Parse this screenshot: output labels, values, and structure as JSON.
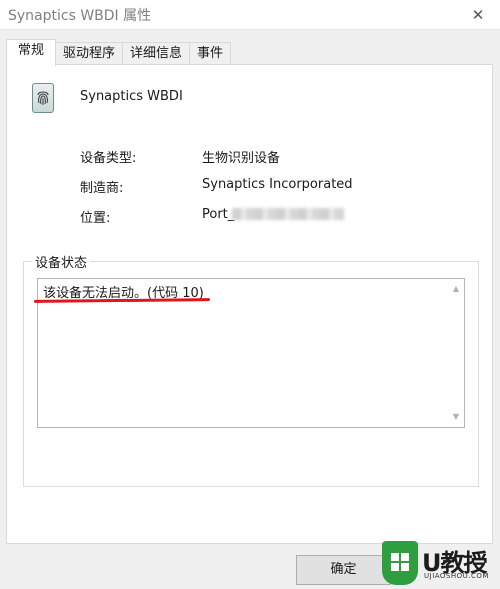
{
  "window": {
    "title": "Synaptics WBDI 属性",
    "close_glyph": "✕"
  },
  "tabs": [
    {
      "label": "常规",
      "active": true
    },
    {
      "label": "驱动程序",
      "active": false
    },
    {
      "label": "详细信息",
      "active": false
    },
    {
      "label": "事件",
      "active": false
    }
  ],
  "device": {
    "icon": "fingerprint-reader-icon",
    "name": "Synaptics WBDI",
    "properties": [
      {
        "label": "设备类型:",
        "value": "生物识别设备"
      },
      {
        "label": "制造商:",
        "value": "Synaptics Incorporated"
      },
      {
        "label": "位置:",
        "value": "Port_"
      }
    ]
  },
  "status": {
    "group_label": "设备状态",
    "text": "该设备无法启动。(代码 10)",
    "annotation_color": "#e0161e"
  },
  "buttons": {
    "ok": "确定"
  },
  "watermark": {
    "brand": "U教授",
    "url": "UJIAOSHOU.COM"
  }
}
